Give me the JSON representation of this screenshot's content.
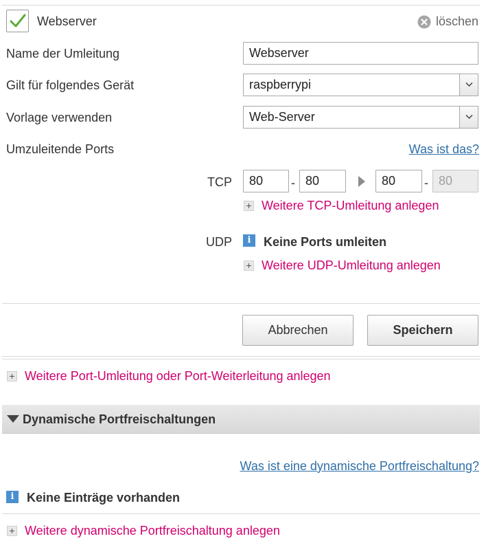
{
  "header": {
    "enabled_checked": true,
    "name": "Webserver",
    "delete_label": "löschen"
  },
  "form": {
    "name_label": "Name der Umleitung",
    "name_value": "Webserver",
    "device_label": "Gilt für folgendes Gerät",
    "device_value": "raspberrypi",
    "template_label": "Vorlage verwenden",
    "template_value": "Web-Server",
    "ports_label": "Umzuleitende Ports",
    "ports_help_link": "Was ist das?"
  },
  "tcp": {
    "label": "TCP",
    "from_start": "80",
    "separator1": "-",
    "from_end": "80",
    "to_start": "80",
    "separator2": "-",
    "to_end": "80",
    "add_link": "Weitere TCP-Umleitung anlegen"
  },
  "udp": {
    "label": "UDP",
    "none_text": "Keine Ports umleiten",
    "add_link": "Weitere UDP-Umleitung anlegen"
  },
  "actions": {
    "cancel": "Abbrechen",
    "save": "Speichern"
  },
  "more_forwarding_link": "Weitere Port-Umleitung oder Port-Weiterleitung anlegen",
  "dynamic": {
    "title": "Dynamische Portfreischaltungen",
    "help_link": "Was ist eine dynamische Portfreischaltung?",
    "empty_text": "Keine Einträge vorhanden",
    "add_link": "Weitere dynamische Portfreischaltung anlegen"
  },
  "colors": {
    "accent_pink": "#d0006f",
    "link_blue": "#2f6fa7",
    "check_green": "#5cab3c",
    "info_blue": "#4a90cf"
  },
  "icons": {
    "checkbox": "checkmark-icon",
    "delete": "close-circle-icon",
    "dropdown": "chevron-down-icon",
    "port_arrow": "arrow-right-icon",
    "add": "plus-icon",
    "info": "info-icon",
    "section_toggle": "triangle-down-icon"
  }
}
